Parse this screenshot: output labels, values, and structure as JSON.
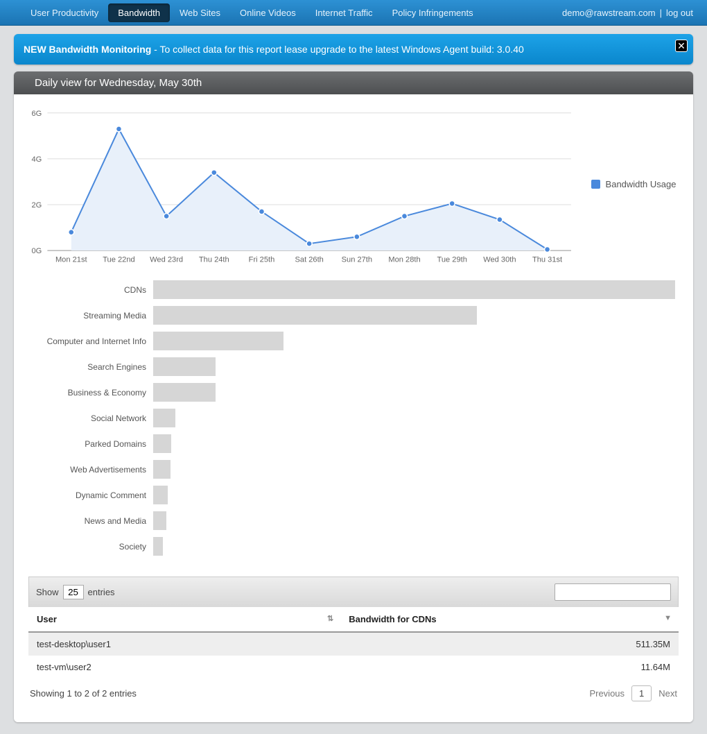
{
  "topbar": {
    "tabs": [
      "User Productivity",
      "Bandwidth",
      "Web Sites",
      "Online Videos",
      "Internet Traffic",
      "Policy Infringements"
    ],
    "active_index": 1,
    "user": "demo@rawstream.com",
    "logout": "log out",
    "sep": "|"
  },
  "banner": {
    "strong": "NEW Bandwidth Monitoring",
    "rest": " - To collect data for this report lease upgrade to the latest Windows Agent build: 3.0.40"
  },
  "panel_title": "Daily view for Wednesday, May 30th",
  "legend_label": "Bandwidth Usage",
  "chart_data": [
    {
      "type": "line",
      "title": "",
      "xlabel": "",
      "ylabel": "",
      "ylim": [
        0,
        6.2
      ],
      "y_unit": "G",
      "y_ticks": [
        0,
        2,
        4,
        6
      ],
      "categories": [
        "Mon 21st",
        "Tue 22nd",
        "Wed 23rd",
        "Thu 24th",
        "Fri 25th",
        "Sat 26th",
        "Sun 27th",
        "Mon 28th",
        "Tue 29th",
        "Wed 30th",
        "Thu 31st"
      ],
      "series": [
        {
          "name": "Bandwidth Usage",
          "values": [
            0.8,
            5.3,
            1.5,
            3.4,
            1.7,
            0.3,
            0.6,
            1.5,
            2.05,
            1.35,
            0.05
          ]
        }
      ]
    },
    {
      "type": "bar",
      "orientation": "horizontal",
      "title": "",
      "xlabel": "",
      "ylabel": "",
      "categories": [
        "CDNs",
        "Streaming Media",
        "Computer and Internet Info",
        "Search Engines",
        "Business & Economy",
        "Social Network",
        "Parked Domains",
        "Web Advertisements",
        "Dynamic Comment",
        "News and Media",
        "Society"
      ],
      "values": [
        100,
        62,
        25,
        12,
        12,
        4.3,
        3.5,
        3.3,
        2.8,
        2.5,
        1.9
      ]
    }
  ],
  "datatable": {
    "length_prefix": "Show",
    "length_value": "25",
    "length_suffix": "entries",
    "columns": [
      "User",
      "Bandwidth for CDNs"
    ],
    "sort_dir": "desc",
    "sort_col": 1,
    "rows": [
      {
        "user": "test-desktop\\user1",
        "bw": "511.35M"
      },
      {
        "user": "test-vm\\user2",
        "bw": "11.64M"
      }
    ],
    "info": "Showing 1 to 2 of 2 entries",
    "prev": "Previous",
    "next": "Next",
    "page": "1"
  }
}
